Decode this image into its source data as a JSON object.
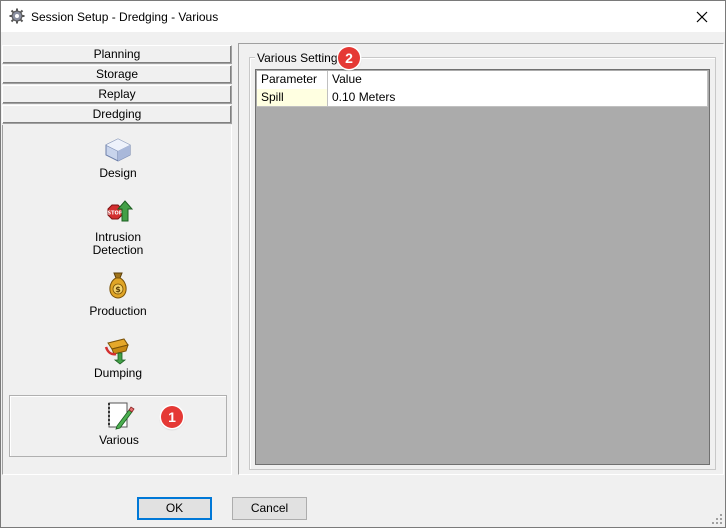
{
  "window": {
    "title": "Session Setup - Dredging -  Various",
    "close_glyph": "✕"
  },
  "nav": {
    "headers": [
      "Planning",
      "Storage",
      "Replay",
      "Dredging"
    ],
    "items": [
      {
        "label": "Design",
        "icon": "box-icon"
      },
      {
        "label": "Intrusion\nDetection",
        "icon": "stop-sign-arrow-icon"
      },
      {
        "label": "Production",
        "icon": "money-bag-icon"
      },
      {
        "label": "Dumping",
        "icon": "dump-icon"
      },
      {
        "label": "Various",
        "icon": "notepad-pencil-icon"
      }
    ],
    "selected": "Various"
  },
  "settings": {
    "group_title": "Various Settings",
    "columns": [
      "Parameter",
      "Value"
    ],
    "rows": [
      {
        "parameter": "Spill",
        "value": "0.10 Meters"
      }
    ]
  },
  "buttons": {
    "ok": "OK",
    "cancel": "Cancel"
  },
  "callouts": [
    "1",
    "2"
  ],
  "colors": {
    "callout": "#e53935",
    "parameter_cell": "#ffffe1",
    "grid_background": "#ababab",
    "focus_border": "#0078d7"
  }
}
